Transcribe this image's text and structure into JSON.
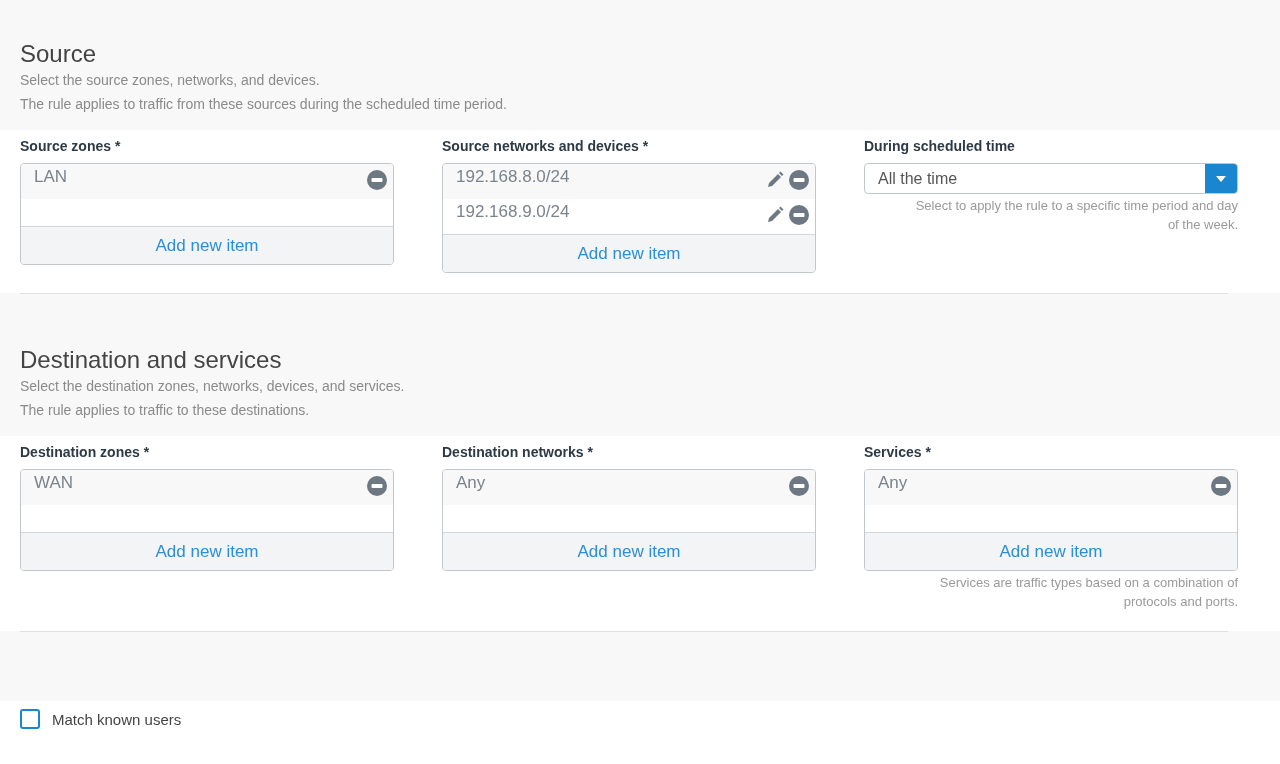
{
  "sections": [
    {
      "title": "Source",
      "description": [
        "Select the source zones, networks, and devices.",
        "The rule applies to traffic from these sources during the scheduled time period."
      ],
      "fields": [
        {
          "kind": "list",
          "label": "Source zones *",
          "items": [
            {
              "text": "LAN",
              "editable": false
            }
          ],
          "add_label": "Add new item"
        },
        {
          "kind": "list",
          "label": "Source networks and devices *",
          "items": [
            {
              "text": "192.168.8.0/24",
              "editable": true
            },
            {
              "text": "192.168.9.0/24",
              "editable": true
            }
          ],
          "add_label": "Add new item"
        },
        {
          "kind": "select",
          "label": "During scheduled time",
          "value": "All the time",
          "help": "Select to apply the rule to a specific time period and day of the week."
        }
      ]
    },
    {
      "title": "Destination and services",
      "description": [
        "Select the destination zones, networks, devices, and services.",
        "The rule applies to traffic to these destinations."
      ],
      "fields": [
        {
          "kind": "list",
          "label": "Destination zones *",
          "items": [
            {
              "text": "WAN",
              "editable": false
            }
          ],
          "add_label": "Add new item"
        },
        {
          "kind": "list",
          "label": "Destination networks *",
          "items": [
            {
              "text": "Any",
              "editable": false
            }
          ],
          "add_label": "Add new item"
        },
        {
          "kind": "list",
          "label": "Services *",
          "items": [
            {
              "text": "Any",
              "editable": false
            }
          ],
          "add_label": "Add new item",
          "help": "Services are traffic types based on a combination of protocols and ports."
        }
      ]
    }
  ],
  "match_known_users": {
    "label": "Match known users",
    "checked": false
  }
}
